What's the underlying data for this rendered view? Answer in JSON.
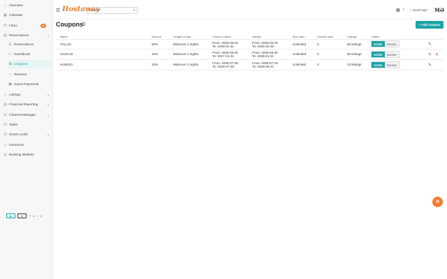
{
  "sidebar": {
    "items": [
      {
        "label": "Overview",
        "icon": "home-icon"
      },
      {
        "label": "Calendar",
        "icon": "calendar-icon"
      },
      {
        "label": "Inbox",
        "icon": "inbox-icon",
        "badge": "36"
      },
      {
        "label": "Reservations",
        "icon": "reservations-icon"
      },
      {
        "label": "Reservations",
        "icon": "list-icon"
      },
      {
        "label": "Guestbook",
        "icon": "book-icon"
      },
      {
        "label": "Coupons",
        "icon": "coupon-icon"
      },
      {
        "label": "Reviews",
        "icon": "star-icon"
      },
      {
        "label": "Guest Payments",
        "icon": "payment-icon"
      },
      {
        "label": "Listings",
        "icon": "listing-icon"
      },
      {
        "label": "Financial Reporting",
        "icon": "report-icon"
      },
      {
        "label": "Channel Manager",
        "icon": "channel-icon"
      },
      {
        "label": "Tasks",
        "icon": "tasks-icon"
      },
      {
        "label": "Smart Locks",
        "icon": "lock-icon"
      },
      {
        "label": "Insurance",
        "icon": "shield-icon"
      },
      {
        "label": "Booking Website",
        "icon": "globe-icon"
      }
    ]
  },
  "topbar": {
    "logo": "Hostaway",
    "search_placeholder": "Search",
    "need_help": "Need help?",
    "avatar": "MƏ"
  },
  "page": {
    "title": "Coupons",
    "add_button": "+ Add coupon"
  },
  "table": {
    "headers": [
      "Name",
      "Amount",
      "Length of stay",
      "Check-in dates",
      "Validity",
      "Max uses",
      "Current uses",
      "Listings",
      "Status"
    ],
    "rows": [
      {
        "name": "TALL20",
        "amount": "20%",
        "stay": "Minimum 2 nights",
        "checkin_from": "From: 2026-06-20",
        "checkin_to": "To: 2028-01-31",
        "valid_from": "From: 2026-06-20",
        "valid_to": "To: 2026-02-29",
        "max_uses": "Unlimited",
        "current_uses": "5",
        "listings": "56 listings",
        "status": "Active"
      },
      {
        "name": "OANA15",
        "amount": "15%",
        "stay": "Minimum 2 nights",
        "checkin_from": "From: 2026-06-20",
        "checkin_to": "To: 2027-12-31",
        "valid_from": "From: 2026-06-20",
        "valid_to": "To: 2028-01-31",
        "max_uses": "Unlimited",
        "current_uses": "0",
        "listings": "56 listings",
        "status": "Active"
      },
      {
        "name": "HUBX10",
        "amount": "10%",
        "stay": "Minimum 2 nights",
        "checkin_from": "From: 2026-07-29",
        "checkin_to": "To: 2026-07-29",
        "valid_from": "From: 2026-07-29",
        "valid_to": "To: 2026-05-31",
        "max_uses": "Unlimited",
        "current_uses": "2",
        "listings": "23 listings",
        "status": "Active"
      }
    ],
    "toggle_active": "Active",
    "toggle_inactive": "Inactive"
  },
  "fab_label": "H",
  "colors": {
    "accent": "#1ba3a6",
    "brand": "#f07b2c",
    "danger": "#e03a3a"
  }
}
